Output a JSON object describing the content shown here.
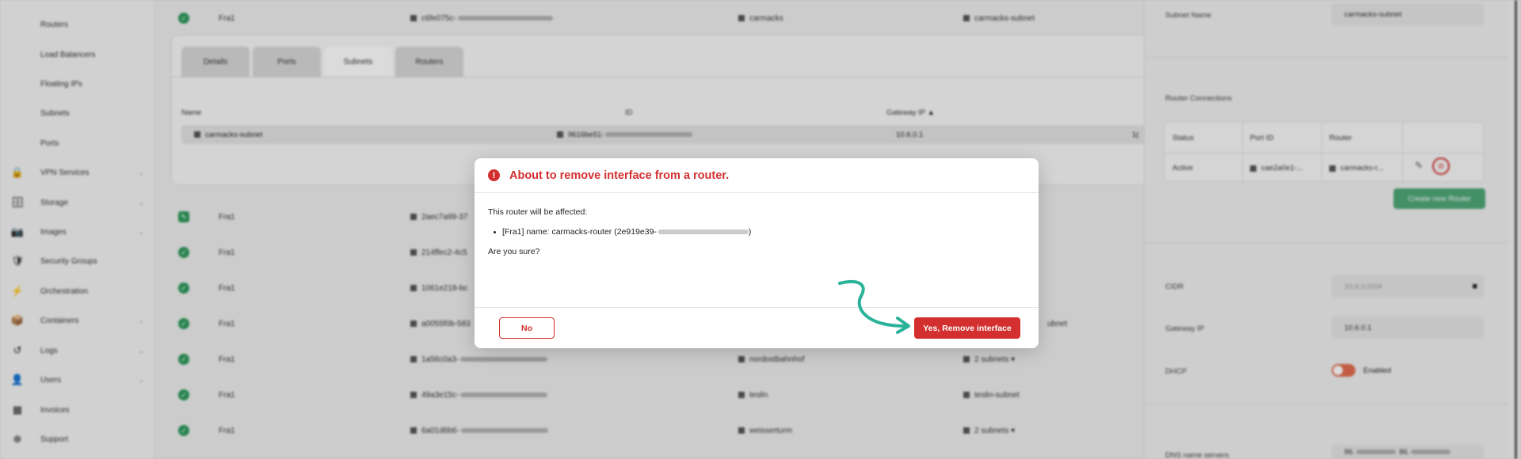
{
  "sidebar": {
    "sub_items": [
      {
        "label": "Routers"
      },
      {
        "label": "Load Balancers"
      },
      {
        "label": "Floating IPs"
      },
      {
        "label": "Subnets"
      },
      {
        "label": "Ports"
      }
    ],
    "items": [
      {
        "label": "VPN Services",
        "icon": "lock-icon",
        "glyph": "🔒",
        "chevron": "⌄"
      },
      {
        "label": "Storage",
        "icon": "database-icon",
        "glyph": "🗄",
        "chevron": "⌄"
      },
      {
        "label": "Images",
        "icon": "camera-icon",
        "glyph": "📷",
        "chevron": "⌄"
      },
      {
        "label": "Security Groups",
        "icon": "shield-icon",
        "glyph": "🛡",
        "chevron": ""
      },
      {
        "label": "Orchestration",
        "icon": "orchestration-icon",
        "glyph": "⚡",
        "chevron": ""
      },
      {
        "label": "Containers",
        "icon": "container-icon",
        "glyph": "📦",
        "chevron": "⌄"
      },
      {
        "label": "Logs",
        "icon": "history-icon",
        "glyph": "↺",
        "chevron": "⌄"
      },
      {
        "label": "Users",
        "icon": "user-icon",
        "glyph": "👤",
        "chevron": "⌄"
      },
      {
        "label": "Invoices",
        "icon": "calculator-icon",
        "glyph": "▦",
        "chevron": ""
      },
      {
        "label": "Support",
        "icon": "support-icon",
        "glyph": "⊕",
        "chevron": ""
      }
    ]
  },
  "table": {
    "top_row": {
      "region": "Fra1",
      "id": "c6fe075c-",
      "network": "carmacks",
      "subnet": "carmacks-subnet"
    },
    "rows": [
      {
        "region": "Fra1",
        "id": "2aec7a99-37",
        "network": "",
        "subnet": ""
      },
      {
        "region": "Fra1",
        "id": "214ffec2-4c5",
        "network": "",
        "subnet": ""
      },
      {
        "region": "Fra1",
        "id": "1061e218-bc",
        "network": "",
        "subnet": ""
      },
      {
        "region": "Fra1",
        "id": "a0055f0b-583",
        "network": "",
        "subnet": "ubnet"
      },
      {
        "region": "Fra1",
        "id": "1a56c0a3-",
        "network": "nordostbahnhof",
        "subnet": "2 subnets ▾"
      },
      {
        "region": "Fra1",
        "id": "49a3e15c-",
        "network": "teslin",
        "subnet": "teslin-subnet"
      },
      {
        "region": "Fra1",
        "id": "6a01d6b6-",
        "network": "weisserturm",
        "subnet": "2 subnets ▾"
      }
    ]
  },
  "detail": {
    "tabs": [
      "Details",
      "Ports",
      "Subnets",
      "Routers"
    ],
    "active_tab": "Subnets",
    "headers": {
      "name": "Name",
      "id": "ID",
      "gateway": "Gateway IP ▲"
    },
    "row": {
      "name": "carmacks-subnet",
      "id": "9616be51-",
      "gateway": "10.6.0.1",
      "extra": "1("
    }
  },
  "right_panel": {
    "subnet_name_label": "Subnet Name",
    "subnet_name_value": "carmacks-subnet",
    "router_connections_label": "Router Connections",
    "rc_headers": [
      "Status",
      "Port ID",
      "Router"
    ],
    "rc_row": {
      "status": "Active",
      "port": "cae2a0e1-...",
      "router": "carmacks-r..."
    },
    "create_router": "Create new Router",
    "cidr_label": "CIDR",
    "cidr_value": "10.6.0.0/24",
    "gateway_label": "Gateway IP",
    "gateway_value": "10.6.0.1",
    "dhcp_label": "DHCP",
    "dhcp_value": "Enabled",
    "dns_label": "DNS name servers",
    "dns_value": "86.",
    "dns_value2": "86."
  },
  "modal": {
    "title": "About to remove interface from a router.",
    "affected_text": "This router will be affected:",
    "router_item": "[Fra1] name: carmacks-router (2e919e39-",
    "router_item_end": ")",
    "confirm_text": "Are you sure?",
    "no_label": "No",
    "yes_label": "Yes, Remove interface"
  },
  "colors": {
    "danger": "#d32f2f",
    "success": "#2e9a5c",
    "accent_green_button": "#4fa878",
    "toggle_on": "#e26c4d"
  }
}
